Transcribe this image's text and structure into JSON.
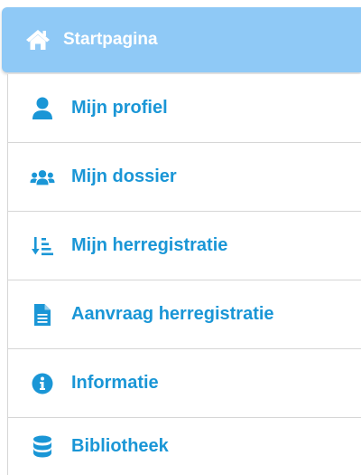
{
  "sidebar": {
    "items": [
      {
        "label": "Startpagina",
        "icon": "home-icon",
        "active": true
      },
      {
        "label": "Mijn profiel",
        "icon": "user-icon",
        "active": false
      },
      {
        "label": "Mijn dossier",
        "icon": "users-group-icon",
        "active": false
      },
      {
        "label": "Mijn herregistratie",
        "icon": "sort-list-icon",
        "active": false
      },
      {
        "label": "Aanvraag herregistratie",
        "icon": "file-icon",
        "active": false
      },
      {
        "label": "Informatie",
        "icon": "info-circle-icon",
        "active": false
      },
      {
        "label": "Bibliotheek",
        "icon": "database-icon",
        "active": false
      }
    ]
  },
  "colors": {
    "accent": "#1a96d6",
    "active_background": "#8fc9f6",
    "active_text": "#ffffff",
    "divider": "#d6d6d6"
  }
}
